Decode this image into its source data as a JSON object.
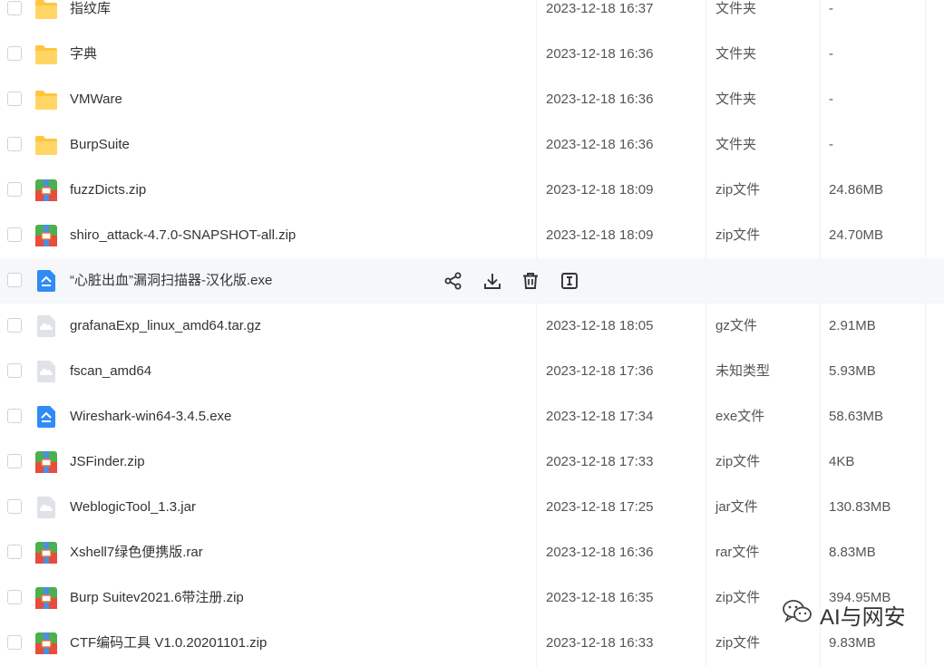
{
  "rows": [
    {
      "name": "指纹库",
      "date": "2023-12-18 16:37",
      "type": "文件夹",
      "size": "-",
      "icon": "folder-icon"
    },
    {
      "name": "字典",
      "date": "2023-12-18 16:36",
      "type": "文件夹",
      "size": "-",
      "icon": "folder-icon"
    },
    {
      "name": "VMWare",
      "date": "2023-12-18 16:36",
      "type": "文件夹",
      "size": "-",
      "icon": "folder-icon"
    },
    {
      "name": "BurpSuite",
      "date": "2023-12-18 16:36",
      "type": "文件夹",
      "size": "-",
      "icon": "folder-icon"
    },
    {
      "name": "fuzzDicts.zip",
      "date": "2023-12-18 18:09",
      "type": "zip文件",
      "size": "24.86MB",
      "icon": "zip-icon"
    },
    {
      "name": "shiro_attack-4.7.0-SNAPSHOT-all.zip",
      "date": "2023-12-18 18:09",
      "type": "zip文件",
      "size": "24.70MB",
      "icon": "zip-icon"
    },
    {
      "name": "“心脏出血”漏洞扫描器-汉化版.exe",
      "date": "",
      "type": "",
      "size": "",
      "icon": "exe-icon",
      "hover": true
    },
    {
      "name": "grafanaExp_linux_amd64.tar.gz",
      "date": "2023-12-18 18:05",
      "type": "gz文件",
      "size": "2.91MB",
      "icon": "unknown-file-icon"
    },
    {
      "name": "fscan_amd64",
      "date": "2023-12-18 17:36",
      "type": "未知类型",
      "size": "5.93MB",
      "icon": "unknown-file-icon"
    },
    {
      "name": "Wireshark-win64-3.4.5.exe",
      "date": "2023-12-18 17:34",
      "type": "exe文件",
      "size": "58.63MB",
      "icon": "exe-icon"
    },
    {
      "name": "JSFinder.zip",
      "date": "2023-12-18 17:33",
      "type": "zip文件",
      "size": "4KB",
      "icon": "zip-icon"
    },
    {
      "name": "WeblogicTool_1.3.jar",
      "date": "2023-12-18 17:25",
      "type": "jar文件",
      "size": "130.83MB",
      "icon": "unknown-file-icon"
    },
    {
      "name": "Xshell7绿色便携版.rar",
      "date": "2023-12-18 16:36",
      "type": "rar文件",
      "size": "8.83MB",
      "icon": "zip-icon"
    },
    {
      "name": "Burp Suitev2021.6带注册.zip",
      "date": "2023-12-18 16:35",
      "type": "zip文件",
      "size": "394.95MB",
      "icon": "zip-icon"
    },
    {
      "name": "CTF编码工具 V1.0.20201101.zip",
      "date": "2023-12-18 16:33",
      "type": "zip文件",
      "size": "9.83MB",
      "icon": "zip-icon"
    }
  ],
  "hover_actions": [
    {
      "name": "share-icon"
    },
    {
      "name": "download-icon"
    },
    {
      "name": "delete-icon"
    },
    {
      "name": "rename-icon"
    }
  ],
  "watermark": {
    "text": "AI与网安",
    "icon": "wechat-icon"
  },
  "colors": {
    "folder": "#ffc53d",
    "zip_top": "#4caf50",
    "zip_bottom": "#e74c3c",
    "zip_band": "#4a90e2",
    "exe": "#2f8cf5",
    "unknown": "#cfd6dd"
  }
}
